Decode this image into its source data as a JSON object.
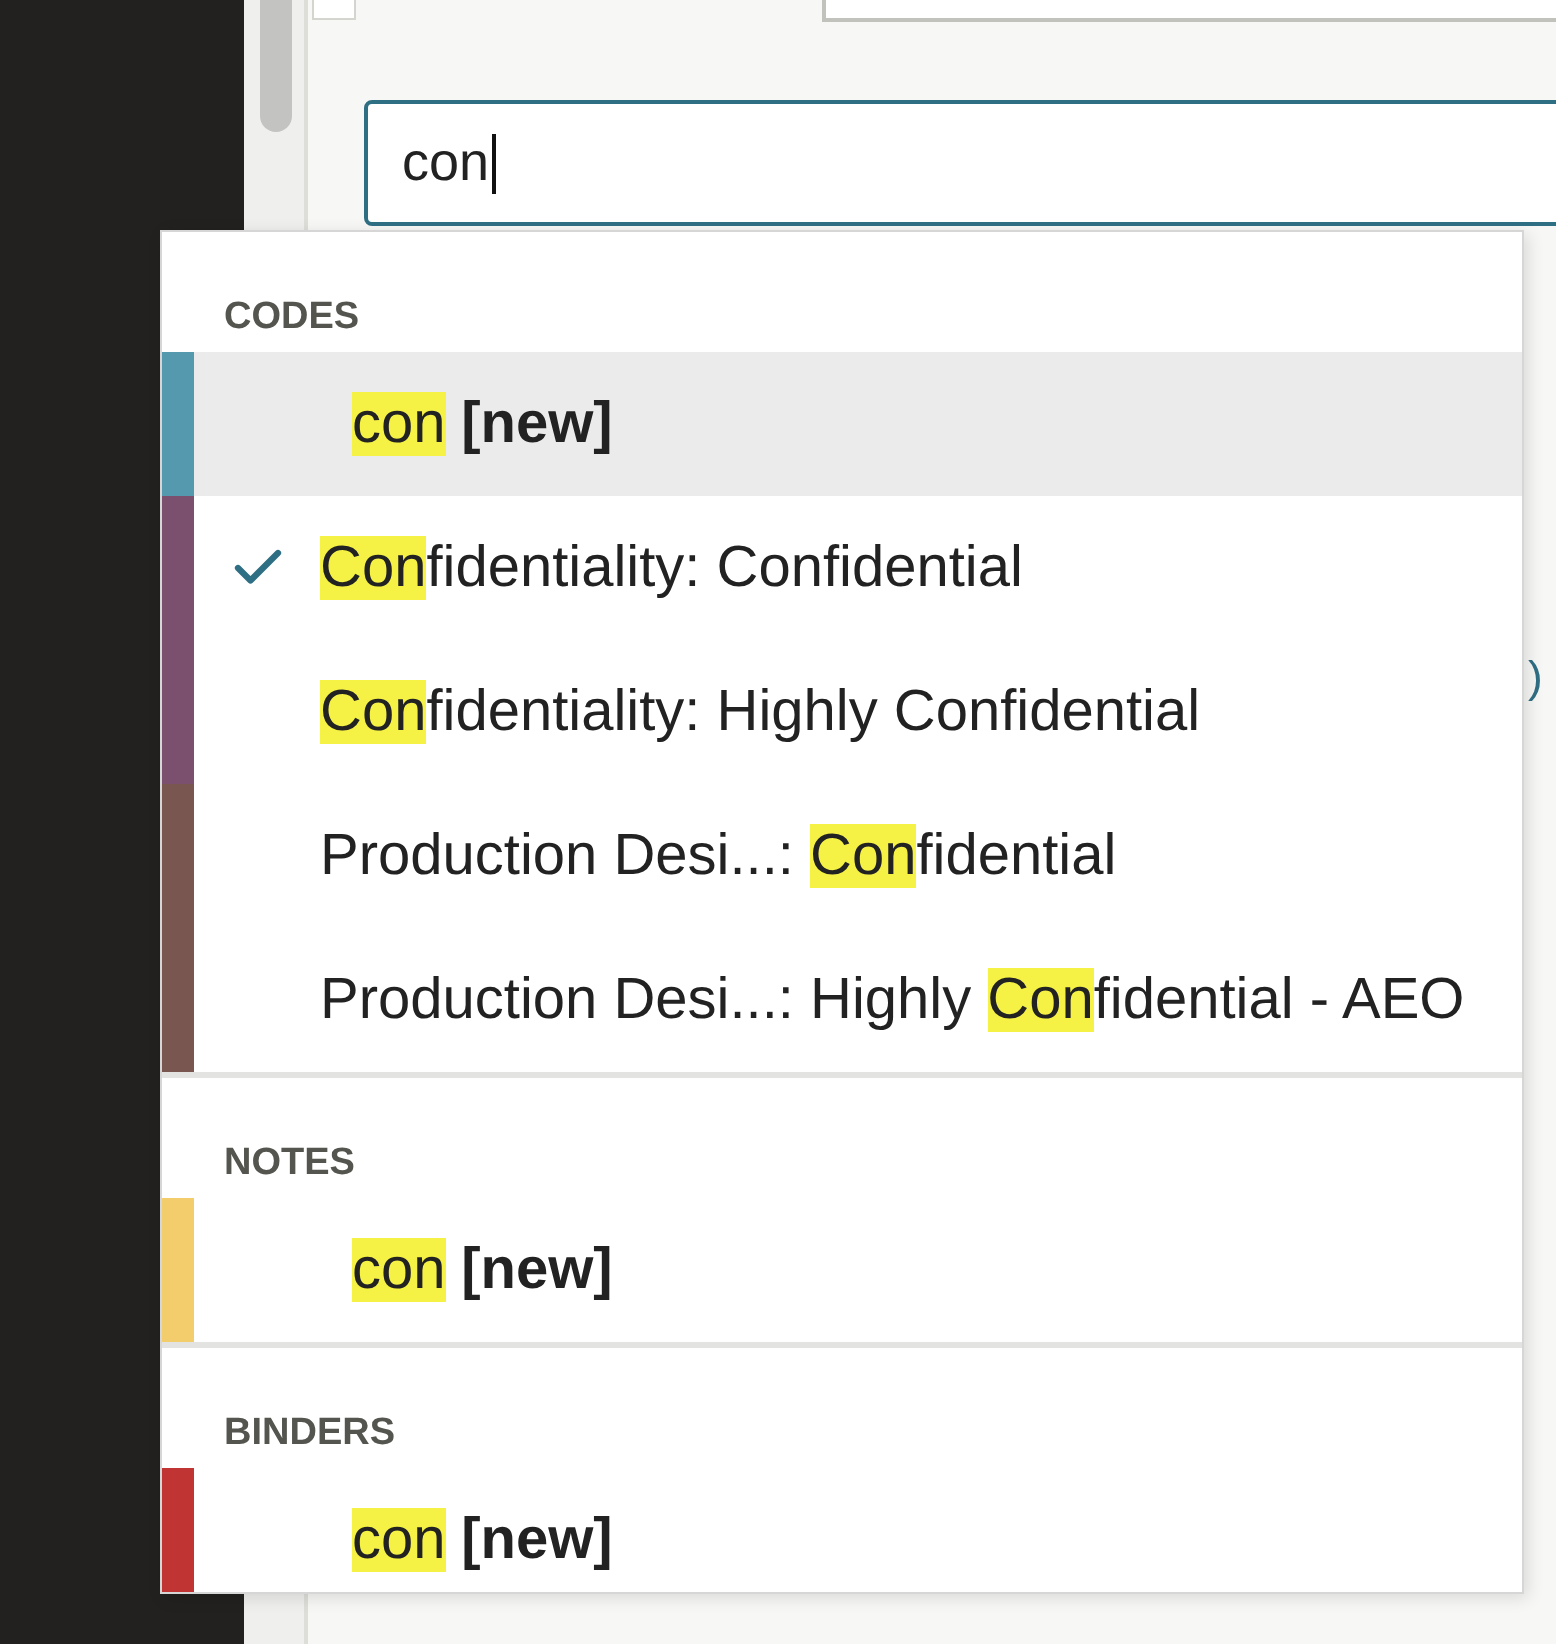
{
  "search": {
    "value": "con"
  },
  "background_fragment": ")",
  "sections": [
    {
      "title": "CODES",
      "items": [
        {
          "kind": "new",
          "color": "#5499ad",
          "selected": true,
          "parts": [
            {
              "text": "con",
              "match": true
            },
            {
              "text": "[new]",
              "bold": true
            }
          ]
        },
        {
          "kind": "code",
          "color": "#7b4f6e",
          "selected": false,
          "checked": true,
          "parts": [
            {
              "text": "Con",
              "match": true
            },
            {
              "text": "fidentiality: Confidential"
            }
          ]
        },
        {
          "kind": "code",
          "color": "#7b4f6e",
          "selected": false,
          "checked": false,
          "parts": [
            {
              "text": "Con",
              "match": true
            },
            {
              "text": "fidentiality: Highly Confidential"
            }
          ]
        },
        {
          "kind": "code",
          "color": "#7a5651",
          "selected": false,
          "checked": false,
          "parts": [
            {
              "text": "Production Desi...: "
            },
            {
              "text": "Con",
              "match": true
            },
            {
              "text": "fidential"
            }
          ]
        },
        {
          "kind": "code",
          "color": "#7a5651",
          "selected": false,
          "checked": false,
          "parts": [
            {
              "text": "Production Desi...: Highly "
            },
            {
              "text": "Con",
              "match": true
            },
            {
              "text": "fidential - AEO"
            }
          ]
        }
      ]
    },
    {
      "title": "NOTES",
      "items": [
        {
          "kind": "new",
          "color": "#f3cd6b",
          "selected": false,
          "parts": [
            {
              "text": "con",
              "match": true
            },
            {
              "text": "[new]",
              "bold": true
            }
          ]
        }
      ]
    },
    {
      "title": "BINDERS",
      "items": [
        {
          "kind": "new",
          "color": "#c03434",
          "selected": false,
          "parts": [
            {
              "text": "con",
              "match": true
            },
            {
              "text": "[new]",
              "bold": true
            }
          ]
        }
      ]
    }
  ]
}
